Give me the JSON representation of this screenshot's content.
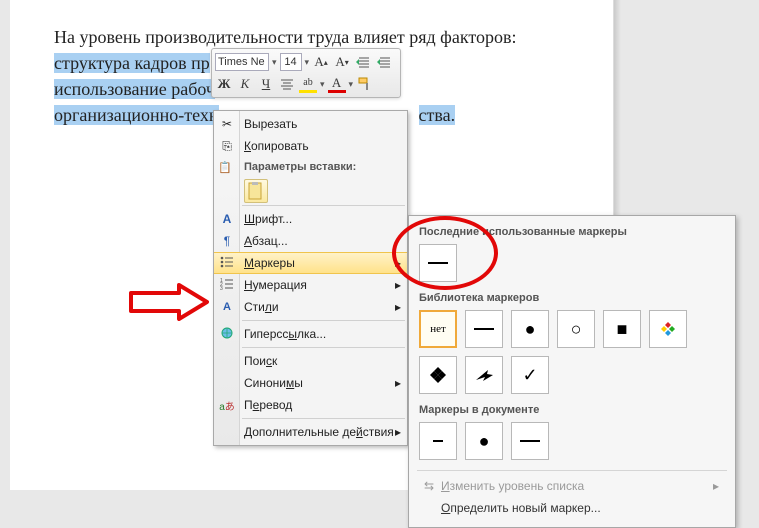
{
  "document": {
    "line1": "На уровень производительности труда влияет ряд факторов:",
    "hl1a": "структура кадров пр",
    "hl2a": "использование рабоч",
    "hl3a": "организационно-техн",
    "hl3b": "ства."
  },
  "miniToolbar": {
    "fontName": "Times Ne",
    "fontSize": "14"
  },
  "contextMenu": {
    "cut": "Вырезать",
    "copy": "Копировать",
    "pasteOptions": "Параметры вставки:",
    "font": "Шрифт...",
    "paragraph": "Абзац...",
    "bullets": "Маркеры",
    "numbering": "Нумерация",
    "styles": "Стили",
    "hyperlink": "Гиперссылка...",
    "find": "Поиск",
    "synonyms": "Синонимы",
    "translate": "Перевод",
    "additional": "Дополнительные действия"
  },
  "bulletsPanel": {
    "recent": "Последние использованные маркеры",
    "library": "Библиотека маркеров",
    "none": "нет",
    "inDocument": "Маркеры в документе",
    "changeLevel": "Изменить уровень списка",
    "defineNew": "Определить новый маркер..."
  }
}
